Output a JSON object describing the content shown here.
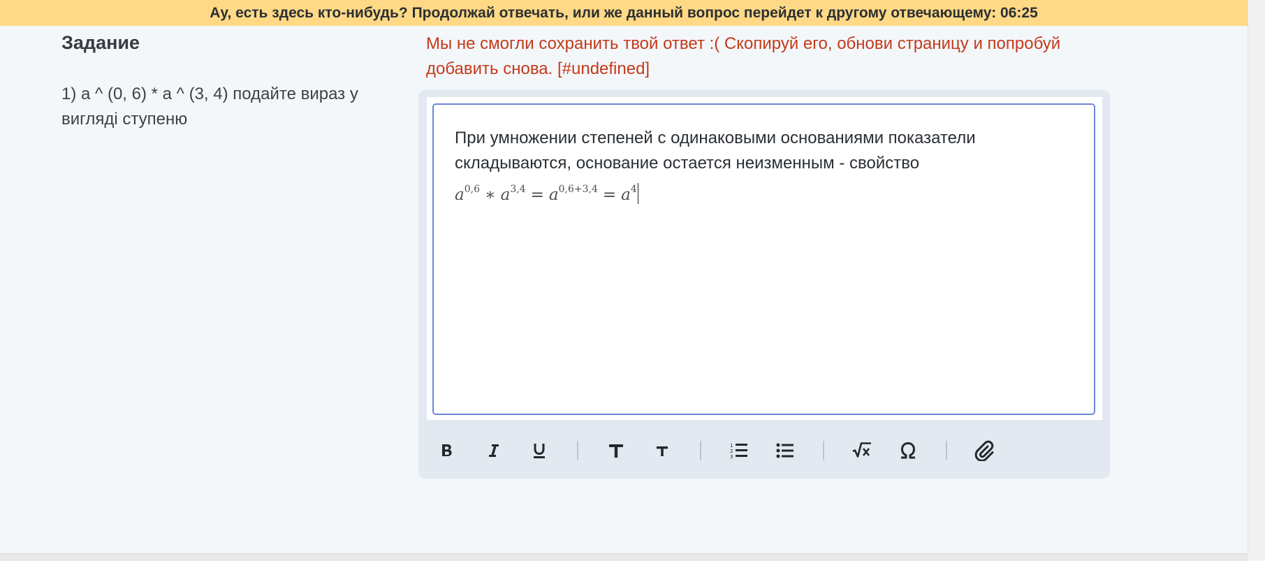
{
  "banner": {
    "text": "Ау, есть здесь кто-нибудь? Продолжай отвечать, или же данный вопрос перейдет к другому отвечающему: 06:25"
  },
  "task": {
    "title": "Задание",
    "text": "1) a ^ (0, 6) * a ^ (3, 4) подайте вираз у вигляді ступеню"
  },
  "error": {
    "text": "Мы не смогли сохранить твой ответ :( Скопируй его, обнови страницу и попробуй добавить снова. [#undefined]"
  },
  "editor": {
    "text": "При умножении степеней с одинаковыми основаниями показатели складываются, основание остается неизменным - свойство",
    "formula": {
      "t1_base": "a",
      "t1_exp": "0,6",
      "op1": "∗",
      "t2_base": "a",
      "t2_exp": "3,4",
      "eq1": "=",
      "t3_base": "a",
      "t3_exp": "0,6+3,4",
      "eq2": "=",
      "t4_base": "a",
      "t4_exp": "4"
    }
  },
  "toolbar": {
    "groups": [
      [
        "bold-icon",
        "italic-icon",
        "underline-icon"
      ],
      [
        "text-large-icon",
        "text-small-icon"
      ],
      [
        "numbered-list-icon",
        "bulleted-list-icon"
      ],
      [
        "square-root-icon",
        "omega-icon"
      ],
      [
        "paperclip-icon"
      ]
    ]
  }
}
